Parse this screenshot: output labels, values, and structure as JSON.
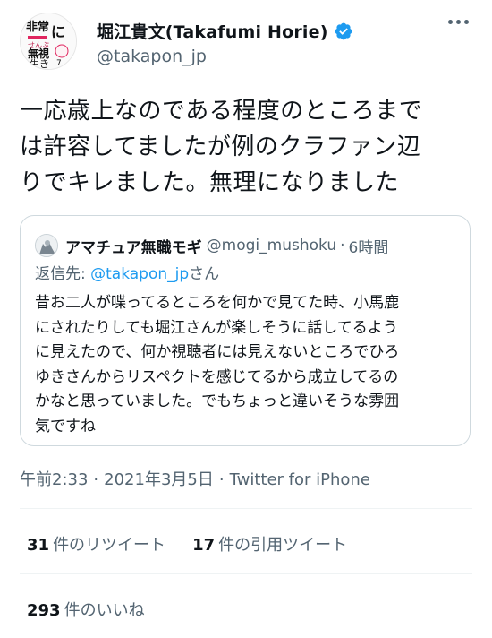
{
  "author": {
    "display_name": "堀江貴文(Takafumi Horie)",
    "handle": "@takapon_jp",
    "avatar_text": [
      "非常",
      "に",
      "せんぶ",
      "無視",
      "生き",
      "7"
    ],
    "verified_color": "#1d9bf0"
  },
  "tweet": {
    "lines": [
      "一応歳上なのである程度のところまで",
      "は許容してましたが例のクラファン辺",
      "りでキレました。無理になりました"
    ]
  },
  "quote": {
    "display_name": "アマチュア無職モギ",
    "handle": "@mogi_mushoku",
    "separator": "·",
    "time": "6時間",
    "reply_prefix": "返信先: ",
    "reply_handle": "@takapon_jp",
    "reply_suffix": "さん",
    "lines": [
      "昔お二人が喋ってるところを何かで見てた時、小馬鹿",
      "にされたりしても堀江さんが楽しそうに話してるよう",
      "に見えたので、何か視聴者には見えないところでひろ",
      "ゆきさんからリスペクトを感じてるから成立してるの",
      "かなと思っていました。でもちょっと違いそうな雰囲",
      "気ですね"
    ]
  },
  "meta": {
    "time": "午前2:33",
    "separator": "·",
    "date": "2021年3月5日",
    "source": "Twitter for iPhone"
  },
  "stats": {
    "retweets_count": "31",
    "retweets_label": "件のリツイート",
    "quotes_count": "17",
    "quotes_label": "件の引用ツイート",
    "likes_count": "293",
    "likes_label": "件のいいね"
  },
  "colors": {
    "text": "#0f1419",
    "secondary": "#536471",
    "link": "#1d9bf0",
    "border": "#cfd9de"
  }
}
